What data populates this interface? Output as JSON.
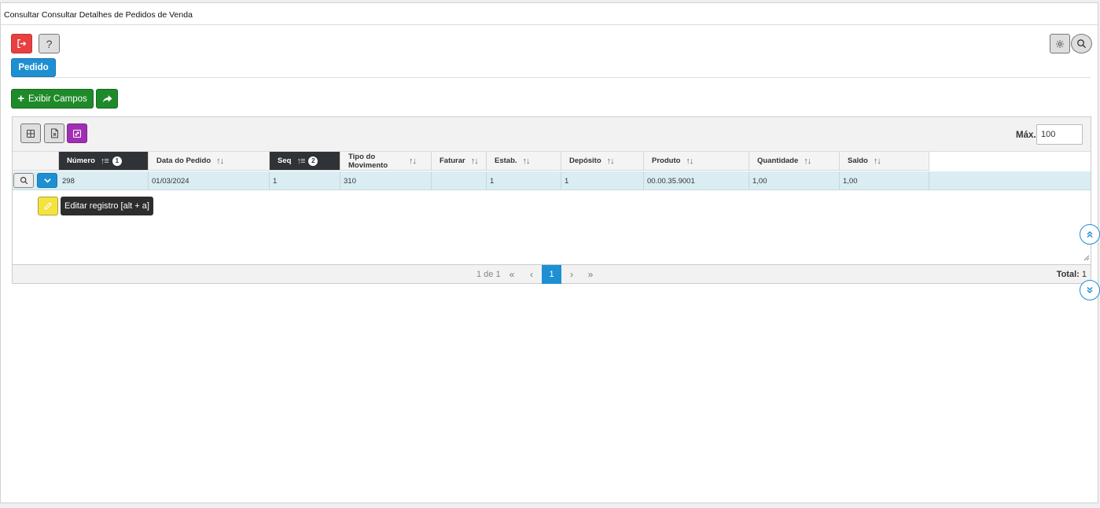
{
  "window": {
    "title": "Consultar Consultar Detalhes de Pedidos de Venda"
  },
  "icons": {
    "exit": "exit-icon",
    "help": "question-icon",
    "gear": "gear-icon",
    "search": "search-icon",
    "share": "share-arrow-icon",
    "grid": "grid-icon",
    "excel": "excel-file-icon",
    "expand": "fullscreen-icon",
    "edit": "pencil-icon",
    "chevron_down": "chevron-down-icon"
  },
  "toolbar": {
    "help_label": "?"
  },
  "tabs": [
    {
      "label": "Pedido"
    }
  ],
  "actions": {
    "exibir_campos_label": "Exibir Campos",
    "plus": "+"
  },
  "grid": {
    "max_label": "Máx.",
    "max_value": "100",
    "columns": [
      {
        "label": "Número",
        "badge": "1",
        "sorted": true
      },
      {
        "label": "Data do Pedido"
      },
      {
        "label": "Seq",
        "badge": "2",
        "sorted": true
      },
      {
        "label": "Tipo do Movimento"
      },
      {
        "label": "Faturar"
      },
      {
        "label": "Estab."
      },
      {
        "label": "Depósito"
      },
      {
        "label": "Produto"
      },
      {
        "label": "Quantidade"
      },
      {
        "label": "Saldo"
      }
    ],
    "rows": [
      {
        "cells": [
          "298",
          "01/03/2024",
          "1",
          "310",
          "",
          "1",
          "1",
          "00.00.35.9001",
          "1,00",
          "1,00"
        ]
      }
    ],
    "tooltip": "Editar registro [alt + a]"
  },
  "pagination": {
    "info": "1 de 1",
    "first": "«",
    "prev": "‹",
    "current": "1",
    "next": "›",
    "last": "»",
    "total_label": "Total:",
    "total_value": "1"
  },
  "colors": {
    "accent_blue": "#1e8fd3",
    "exit_red": "#e84040",
    "action_green": "#1f8a2a",
    "purple": "#a02fb3",
    "edit_yellow": "#f2e341",
    "header_dark": "#2f3236",
    "row_highlight": "#daedf2"
  }
}
